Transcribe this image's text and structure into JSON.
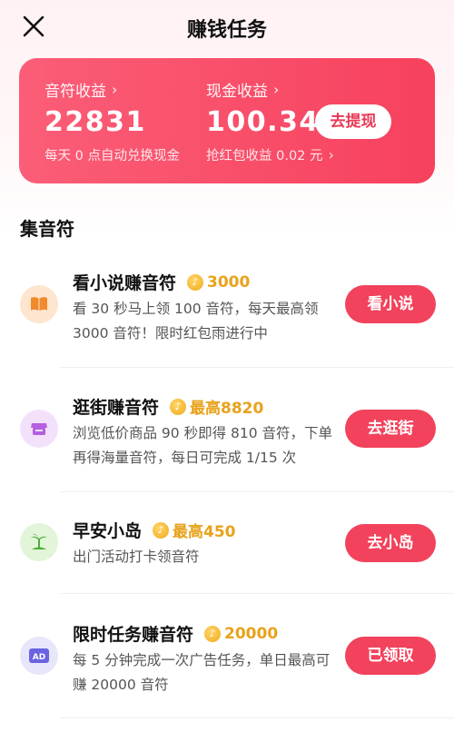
{
  "header": {
    "title": "赚钱任务"
  },
  "earnings": {
    "notes_label": "音符收益",
    "notes_value": "22831",
    "notes_sub": "每天 0 点自动兑换现金",
    "cash_label": "现金收益",
    "cash_value": "100.34",
    "cash_sub": "抢红包收益 0.02 元",
    "withdraw_label": "去提现",
    "chevron": "›"
  },
  "section": {
    "title": "集音符"
  },
  "tasks": [
    {
      "icon": "book-icon",
      "title": "看小说赚音符",
      "reward": "3000",
      "desc": "看 30 秒马上领 100 音符，每天最高领 3000 音符！限时红包雨进行中",
      "button": "看小说"
    },
    {
      "icon": "shop-icon",
      "title": "逛街赚音符",
      "reward": "最高8820",
      "desc": "浏览低价商品 90 秒即得 810 音符，下单再得海量音符，每日可完成 1/15 次",
      "button": "去逛街"
    },
    {
      "icon": "island-icon",
      "title": "早安小岛",
      "reward": "最高450",
      "desc": "出门活动打卡领音符",
      "button": "去小岛"
    },
    {
      "icon": "ad-icon",
      "title": "限时任务赚音符",
      "reward": "20000",
      "desc": "每 5 分钟完成一次广告任务，单日最高可赚 20000 音符",
      "button": "已领取"
    }
  ],
  "colors": {
    "accent": "#f2425c",
    "reward": "#e8a21a"
  }
}
